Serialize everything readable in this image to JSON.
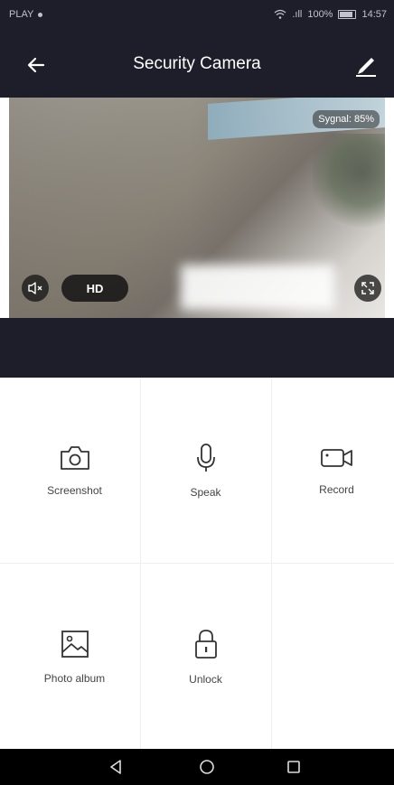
{
  "status": {
    "carrier": "PLAY",
    "signal_text": ".ıll",
    "battery": "100%",
    "time": "14:57"
  },
  "header": {
    "title": "Security Camera",
    "back_icon": "arrow-left-icon",
    "edit_icon": "pencil-icon"
  },
  "video": {
    "signal_label": "Sygnal: 85%",
    "quality_label": "HD",
    "mute_icon": "speaker-mute-icon",
    "fullscreen_icon": "fullscreen-icon"
  },
  "actions": [
    {
      "label": "Screenshot",
      "icon": "camera-icon"
    },
    {
      "label": "Speak",
      "icon": "microphone-icon"
    },
    {
      "label": "Record",
      "icon": "video-camera-icon"
    },
    {
      "label": "Photo album",
      "icon": "image-icon"
    },
    {
      "label": "Unlock",
      "icon": "lock-icon"
    }
  ],
  "colors": {
    "header_bg": "#1d1e2a",
    "nav_bg": "#000000"
  }
}
